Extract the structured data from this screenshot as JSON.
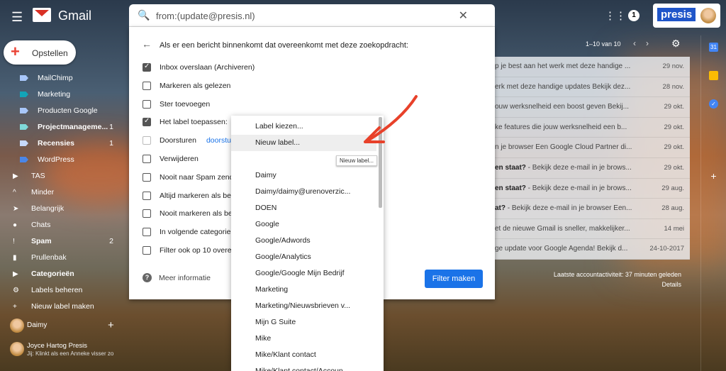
{
  "header": {
    "brand": "Gmail",
    "search_query": "from:(update@presis.nl)",
    "notifications": "1",
    "account_logo": "presis"
  },
  "compose": {
    "label": "Opstellen"
  },
  "sidebar": {
    "items": [
      {
        "label": "MailChimp",
        "color": "#a8c7fa",
        "bold": false,
        "count": ""
      },
      {
        "label": "Marketing",
        "color": "#12a4b8",
        "bold": false,
        "count": ""
      },
      {
        "label": "Producten Google",
        "color": "#a8c7fa",
        "bold": false,
        "count": ""
      },
      {
        "label": "Projectmanageme...",
        "color": "#7fd9d9",
        "bold": true,
        "count": "1"
      },
      {
        "label": "Recensies",
        "color": "#c6dafc",
        "bold": true,
        "count": "1"
      },
      {
        "label": "WordPress",
        "color": "#4a86e8",
        "bold": false,
        "count": ""
      }
    ],
    "system": [
      {
        "label": "TAS",
        "icon": "label-icon",
        "bold": false,
        "count": ""
      },
      {
        "label": "Minder",
        "icon": "chevron-up-icon",
        "bold": false,
        "count": ""
      },
      {
        "label": "Belangrijk",
        "icon": "important-icon",
        "bold": false,
        "count": ""
      },
      {
        "label": "Chats",
        "icon": "chat-icon",
        "bold": false,
        "count": ""
      },
      {
        "label": "Spam",
        "icon": "spam-icon",
        "bold": true,
        "count": "2"
      },
      {
        "label": "Prullenbak",
        "icon": "trash-icon",
        "bold": false,
        "count": ""
      },
      {
        "label": "Categorieën",
        "icon": "label-icon",
        "bold": true,
        "count": ""
      },
      {
        "label": "Labels beheren",
        "icon": "gear-icon",
        "bold": false,
        "count": ""
      },
      {
        "label": "Nieuw label maken",
        "icon": "plus-icon",
        "bold": false,
        "count": ""
      }
    ],
    "user": "Daimy",
    "chat_contact": {
      "name": "Joyce Hartog Presis",
      "snippet": "Jij: Klinkt als een Anneke visser zo"
    }
  },
  "filter_dialog": {
    "title": "Als er een bericht binnenkomt dat overeenkomt met deze zoekopdracht:",
    "options": [
      {
        "label": "Inbox overslaan (Archiveren)",
        "checked": true
      },
      {
        "label": "Markeren als gelezen",
        "checked": false
      },
      {
        "label": "Ster toevoegen",
        "checked": false
      },
      {
        "label": "Het label toepassen:",
        "checked": true
      },
      {
        "label": "Doorsturen",
        "checked": false,
        "link": "doorstu"
      },
      {
        "label": "Verwijderen",
        "checked": false
      },
      {
        "label": "Nooit naar Spam zend",
        "checked": false
      },
      {
        "label": "Altijd markeren als be",
        "checked": false
      },
      {
        "label": "Nooit markeren als be",
        "checked": false
      },
      {
        "label": "In volgende categorie",
        "checked": false
      },
      {
        "label": "Filter ook op 10 overe",
        "checked": false
      }
    ],
    "help": "Meer informatie",
    "create_button": "Filter maken"
  },
  "label_dropdown": {
    "items": [
      "Label kiezen...",
      "Nieuw label...",
      "",
      "Daimy",
      "Daimy/daimy@urenoverzic...",
      "DOEN",
      "Google",
      "Google/Adwords",
      "Google/Analytics",
      "Google/Google Mijn Bedrijf",
      "Marketing",
      "Marketing/Nieuwsbrieven v...",
      "Mijn G Suite",
      "Mike",
      "Mike/Klant contact",
      "Mike/Klant contact/Accoun..."
    ],
    "highlighted": "Nieuw label...",
    "tooltip": "Nieuw label..."
  },
  "mail_list": {
    "pager": "1–10 van 10",
    "rows": [
      {
        "snippet": "p je best aan het werk met deze handige ...",
        "date": "29 nov."
      },
      {
        "snippet": "erk met deze handige updates Bekijk dez...",
        "date": "28 nov."
      },
      {
        "snippet": "ouw werksnelheid een boost geven Bekij...",
        "date": "29 okt."
      },
      {
        "snippet": "ke features die jouw werksnelheid een b...",
        "date": "29 okt."
      },
      {
        "snippet": "n je browser Een Google Cloud Partner di...",
        "date": "29 okt."
      },
      {
        "bold": "en staat?",
        "snippet": " - Bekijk deze e-mail in je brows...",
        "date": "29 okt."
      },
      {
        "bold": "en staat?",
        "snippet": " - Bekijk deze e-mail in je brows...",
        "date": "29 aug."
      },
      {
        "bold": "at?",
        "snippet": " - Bekijk deze e-mail in je browser Een...",
        "date": "28 aug."
      },
      {
        "snippet": "et de nieuwe Gmail is sneller, makkelijker...",
        "date": "14 mei"
      },
      {
        "snippet": "ge update voor Google Agenda! Bekijk d...",
        "date": "24-10-2017"
      }
    ],
    "activity": "Laatste accountactiviteit: 37 minuten geleden",
    "details": "Details"
  },
  "right_rail": {
    "calendar_day": "31"
  }
}
